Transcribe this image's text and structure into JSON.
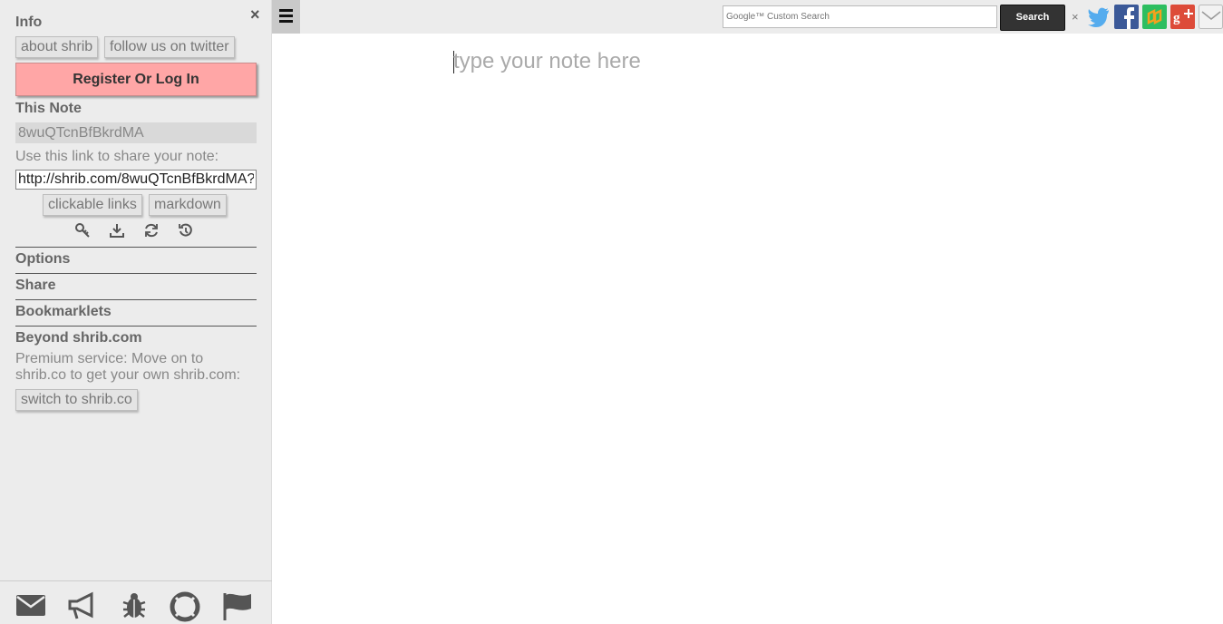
{
  "sidebar": {
    "close_glyph": "×",
    "info": {
      "title": "Info",
      "about_label": "about shrib",
      "twitter_label": "follow us on twitter",
      "register_label": "Register Or Log In"
    },
    "this_note": {
      "title": "This Note",
      "note_id": "8wuQTcnBfBkrdMA",
      "share_hint": "Use this link to share your note:",
      "share_link": "http://shrib.com/8wuQTcnBfBkrdMA?",
      "clickable_links_label": "clickable links",
      "markdown_label": "markdown",
      "tool_icons": [
        "key-icon",
        "download-icon",
        "refresh-icon",
        "history-icon"
      ]
    },
    "sections": [
      "Options",
      "Share",
      "Bookmarklets"
    ],
    "beyond": {
      "title": "Beyond shrib.com",
      "text": "Premium service: Move on to shrib.co to get your own shrib.com:",
      "switch_label": "switch to shrib.co"
    },
    "footer_icons": [
      "mail-icon",
      "megaphone-icon",
      "bug-icon",
      "lifebuoy-icon",
      "flag-icon"
    ]
  },
  "topbar": {
    "menu_glyph": "≡",
    "search_placeholder": "Google™ Custom Search",
    "search_button": "Search",
    "clear_glyph": "×",
    "social_icons": [
      "twitter-icon",
      "facebook-icon",
      "evernote-icon",
      "google-plus-icon",
      "email-icon"
    ],
    "colors": {
      "twitter": "#55acee",
      "facebook": "#3b5998",
      "green": "#2dbe60",
      "google_plus": "#dd4b39"
    }
  },
  "editor": {
    "placeholder": "type your note here"
  }
}
